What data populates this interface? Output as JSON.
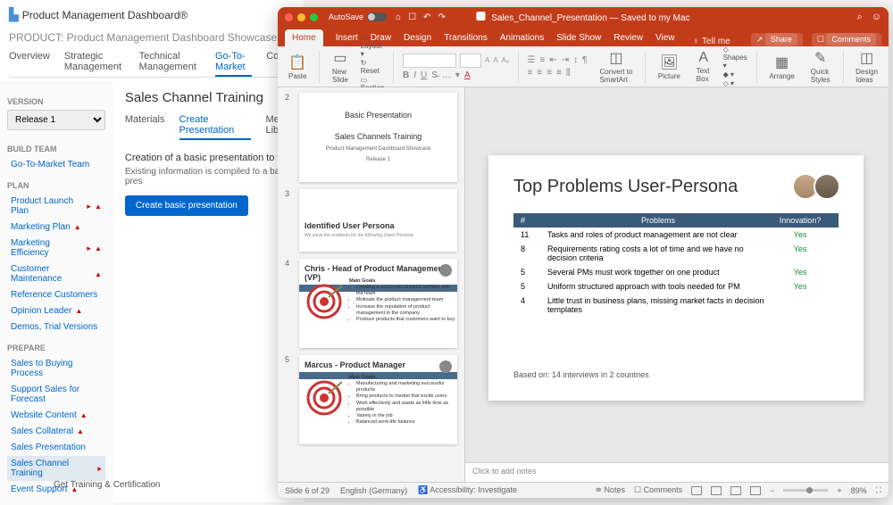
{
  "browser": {
    "logo": "Product Management Dashboard®",
    "product_label": "PRODUCT: Product Management Dashboard Showcase",
    "tabs": [
      "Overview",
      "Strategic Management",
      "Technical Management",
      "Go-To-Market",
      "Config"
    ],
    "active_tab": 3,
    "version_head": "VERSION",
    "version_value": "Release 1",
    "sections": {
      "build": {
        "head": "BUILD TEAM",
        "items": [
          {
            "label": "Go-To-Market Team"
          }
        ]
      },
      "plan": {
        "head": "PLAN",
        "items": [
          {
            "label": "Product Launch Plan",
            "flag": true,
            "warn": true
          },
          {
            "label": "Marketing Plan",
            "warn": true
          },
          {
            "label": "Marketing Efficiency",
            "flag": true,
            "warn": true
          },
          {
            "label": "Customer Maintenance",
            "warn": true
          },
          {
            "label": "Reference Customers"
          },
          {
            "label": "Opinion Leader",
            "warn": true
          },
          {
            "label": "Demos, Trial Versions"
          }
        ]
      },
      "prepare": {
        "head": "PREPARE",
        "items": [
          {
            "label": "Sales to Buying Process"
          },
          {
            "label": "Support Sales for Forecast"
          },
          {
            "label": "Website Content",
            "warn": true
          },
          {
            "label": "Sales Collateral",
            "warn": true
          },
          {
            "label": "Sales Presentation"
          },
          {
            "label": "Sales Channel Training",
            "flag": true,
            "sel": true
          },
          {
            "label": "Event Support",
            "warn": true
          }
        ]
      }
    },
    "page_title": "Sales Channel Training",
    "subtabs": [
      "Materials",
      "Create Presentation",
      "Media Libr"
    ],
    "active_subtab": 1,
    "desc": "Creation of a basic presentation to train",
    "desc2": "Existing information is compiled to a basic pres",
    "button": "Create basic presentation",
    "footer": "Get Training & Certification"
  },
  "ppt": {
    "autosave": "AutoSave",
    "title": "Sales_Channel_Presentation — Saved to my Mac",
    "tabs": [
      "Home",
      "Insert",
      "Draw",
      "Design",
      "Transitions",
      "Animations",
      "Slide Show",
      "Review",
      "View"
    ],
    "tellme": "Tell me",
    "share": "Share",
    "comments": "Comments",
    "ribbon": {
      "paste": "Paste",
      "newslide": "New\nSlide",
      "layout": "Layout",
      "reset": "Reset",
      "section": "Section",
      "convert": "Convert to\nSmartArt",
      "picture": "Picture",
      "textbox": "Text Box",
      "shapes": "Shapes",
      "arrange": "Arrange",
      "quick": "Quick\nStyles",
      "ideas": "Design\nIdeas"
    },
    "thumbs": [
      {
        "n": "2",
        "title": "Basic Presentation",
        "subtitle": "Sales Channels Training",
        "line1": "Product Management Dashboard Showcase",
        "line2": "Release 1"
      },
      {
        "n": "3",
        "title": "Identified User Persona",
        "sub": "We solve the problems for the following Users Persona"
      },
      {
        "n": "4",
        "title": "Chris - Head of Product Management (VP)",
        "goals": "Main Goals",
        "bullets": [
          "Creating a successful product portfolio with the team",
          "Motivate the product management team",
          "Increase the reputation of product management in the company",
          "Produce products that customers want to buy"
        ]
      },
      {
        "n": "5",
        "title": "Marcus - Product Manager",
        "goals": "Main Goals",
        "bullets": [
          "Manufacturing and marketing successful products",
          "Bring products to market that excite users",
          "Work effectively and waste as little time as possible",
          "Variety in the job",
          "Balanced work-life balance"
        ]
      }
    ],
    "slide": {
      "title": "Top Problems User-Persona",
      "cols": {
        "n": "#",
        "p": "Problems",
        "i": "Innovation?"
      },
      "rows": [
        {
          "n": "11",
          "p": "Tasks and roles of product management are not clear",
          "i": "Yes"
        },
        {
          "n": "8",
          "p": "Requirements rating costs a lot of time and we have no decision criteria",
          "i": "Yes"
        },
        {
          "n": "5",
          "p": "Several PMs must work together on one product",
          "i": "Yes"
        },
        {
          "n": "5",
          "p": "Uniform structured approach with tools needed for PM",
          "i": "Yes"
        },
        {
          "n": "4",
          "p": "Little trust in business plans, missing market facts in decision templates",
          "i": ""
        }
      ],
      "based": "Based on: 14 interviews in 2 countries"
    },
    "notes": "Click to add notes",
    "status": {
      "slide": "Slide 6 of 29",
      "lang": "English (Germany)",
      "acc": "Accessibility: Investigate",
      "notes": "Notes",
      "comments": "Comments",
      "zoom": "89%"
    }
  }
}
